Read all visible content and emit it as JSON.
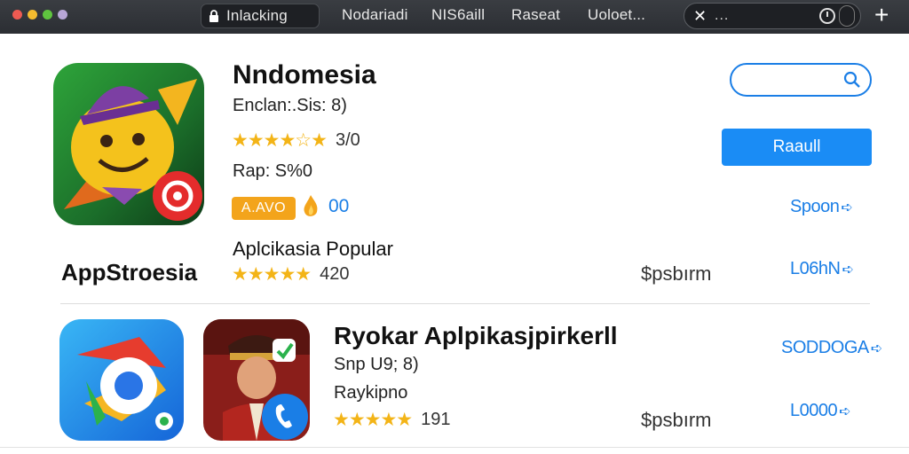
{
  "window": {
    "traffic_lights": [
      "#ee5a52",
      "#f4bb2f",
      "#5fc43f",
      "#b8a6d6"
    ],
    "lock_tab": "Inlacking",
    "tabs": [
      "Nodariadi",
      "NIS6aill",
      "Raseat",
      "Uoloet..."
    ],
    "search": {
      "close_glyph": "✕",
      "dots": "...",
      "icons": [
        "clock-icon",
        "toggle-icon"
      ]
    },
    "new_tab_glyph": "+"
  },
  "featured": {
    "title": "Nndomesia",
    "subtitle": "Enclan:.Sis:  8)",
    "stars": "★★★★☆★",
    "rating": "3/0",
    "rap": "Rap: S%0",
    "badge": "A.AVO",
    "badge_count": "00",
    "search_placeholder": "",
    "primary_button": "Raaull",
    "link": "Spoon",
    "accent": "#1a7ee6"
  },
  "popular": {
    "brand": "AppStroesia",
    "heading": "Aplcikasia Popular",
    "stars": "★★★★★",
    "rating": "420",
    "price": "$psbırm",
    "link": "L06hN"
  },
  "second_app": {
    "title": "Ryokar Aplpikasjpirkerll",
    "subtitle": "Snp U9; 8)",
    "developer": "Raykipno",
    "stars": "★★★★★",
    "rating": "191",
    "price": "$psbırm",
    "link_top": "SODDOGA",
    "link_bottom": "L0000"
  }
}
